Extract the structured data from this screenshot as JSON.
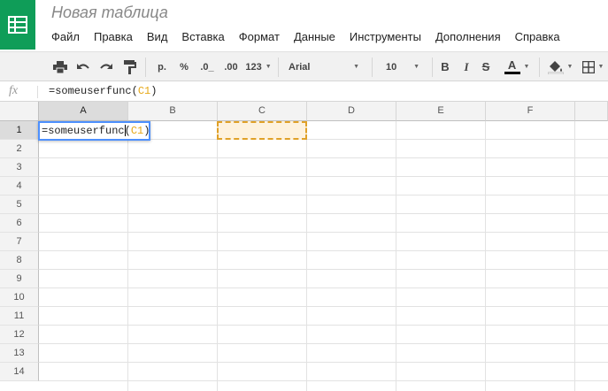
{
  "header": {
    "title": "Новая таблица",
    "menu": [
      "Файл",
      "Правка",
      "Вид",
      "Вставка",
      "Формат",
      "Данные",
      "Инструменты",
      "Дополнения",
      "Справка"
    ]
  },
  "toolbar": {
    "currency": "р.",
    "percent": "%",
    "decrease_decimals": ".0_",
    "increase_decimals": ".00",
    "more_formats": "123",
    "font": "Arial",
    "font_size": "10",
    "bold": "B",
    "italic": "I",
    "strikethrough": "S",
    "text_color_label": "A"
  },
  "formula_bar": {
    "fx_label": "fx",
    "formula_prefix": "=someuserfunc(",
    "formula_ref": "C1",
    "formula_suffix": ")"
  },
  "sheet": {
    "columns": [
      "A",
      "B",
      "C",
      "D",
      "E",
      "F"
    ],
    "rows": [
      "1",
      "2",
      "3",
      "4",
      "5",
      "6",
      "7",
      "8",
      "9",
      "10",
      "11",
      "12",
      "13",
      "14"
    ],
    "active_cell": "A1",
    "editing": {
      "prefix": "=someuserfunc",
      "paren_open": "(",
      "ref": "C1",
      "paren_close": ")"
    },
    "referenced_cell": "C1"
  },
  "colors": {
    "brand": "#0f9d58",
    "selection": "#4d90fe",
    "reference": "#e0a128",
    "text_color_underline": "#000000"
  },
  "icons": [
    "sheets-logo-icon",
    "print-icon",
    "undo-icon",
    "redo-icon",
    "paint-format-icon",
    "fill-color-icon",
    "borders-icon"
  ]
}
